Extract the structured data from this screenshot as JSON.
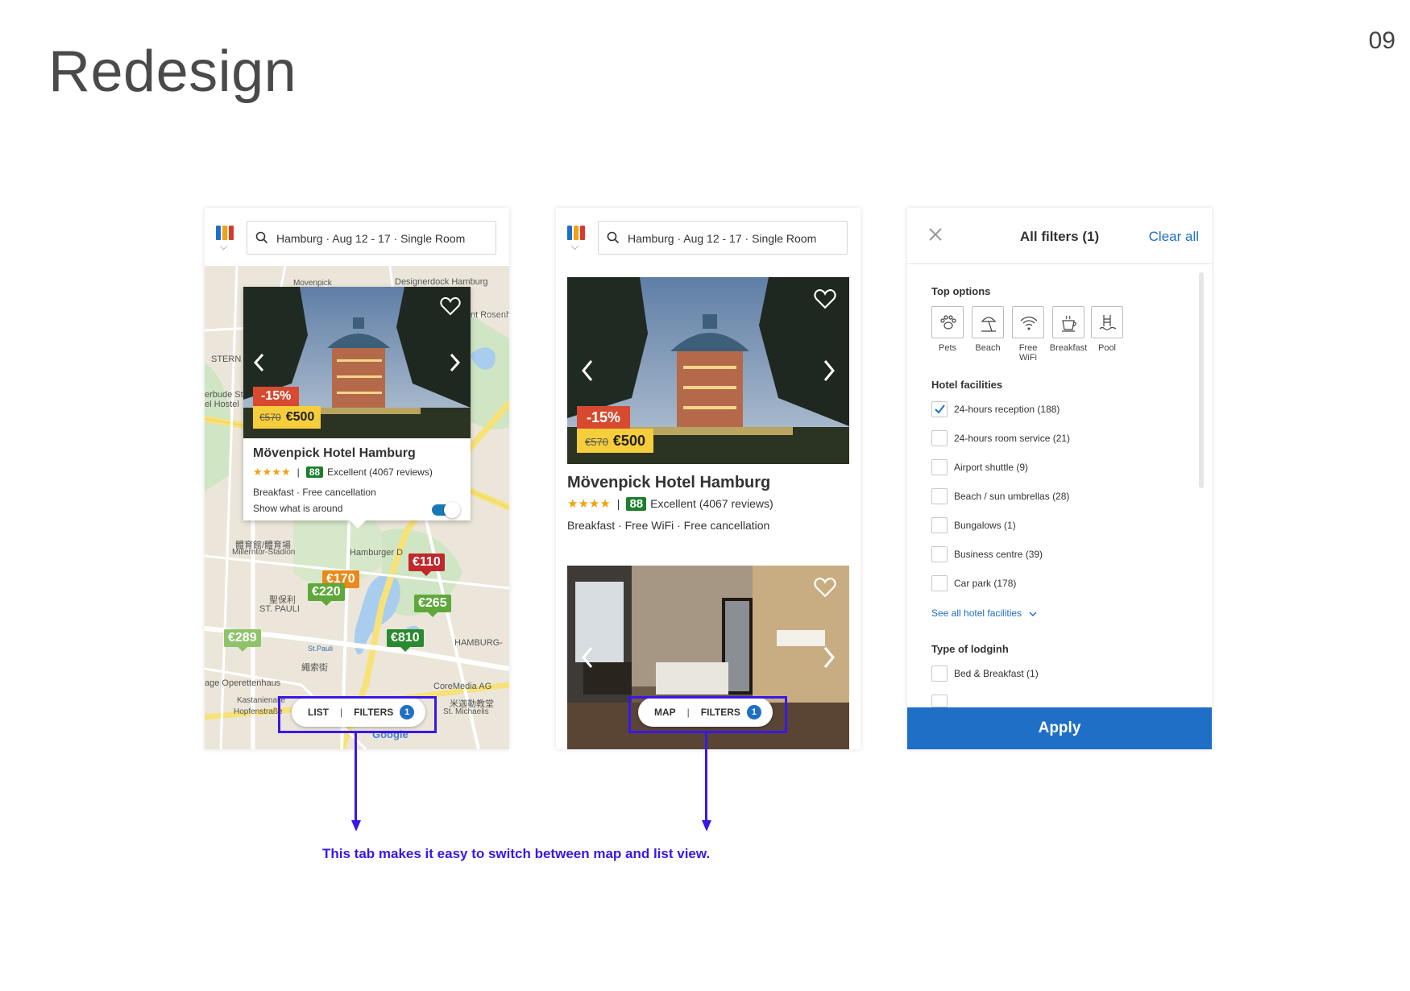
{
  "slide": {
    "title": "Redesign",
    "page_number": "09"
  },
  "search": {
    "query": "Hamburg · Aug 12 - 17 · Single Room"
  },
  "hotel": {
    "name": "Mövenpick Hotel Hamburg",
    "discount": "-15%",
    "old_price": "€570",
    "price": "€500",
    "stars": "★★★★",
    "score": "88",
    "rating_text": "Excellent (4067 reviews)",
    "map_features": "Breakfast · Free cancellation",
    "list_features": "Breakfast · Free WiFi · Free cancellation",
    "show_around": "Show what is around",
    "show_around_on": true
  },
  "map": {
    "pins": [
      {
        "label": "€110",
        "color": "#c0282d"
      },
      {
        "label": "€170",
        "color": "#e88a1a"
      },
      {
        "label": "€220",
        "color": "#5fa83c"
      },
      {
        "label": "€265",
        "color": "#5fa83c"
      },
      {
        "label": "€289",
        "color": "#8fc36a"
      },
      {
        "label": "€810",
        "color": "#2a8a2f"
      }
    ],
    "labels": {
      "a": "Designerdock Hamburg",
      "b": "nt Rosenh",
      "c": "STERN",
      "d": "erbude St",
      "e": "el Hostel",
      "f": "體育館/體育場",
      "g": "Millerntor-Stadion",
      "h": "Hamburger D",
      "i": "聖保利",
      "j": "ST. PAULI",
      "k": "St.Pauli",
      "l": "HAMBURG-",
      "m": "age Operettenhaus",
      "n": "CoreMedia AG",
      "o": "Kastanienalle",
      "p": "Hopfenstraße",
      "q": "Google",
      "r": "Movenpick",
      "s": "米迦勒教堂",
      "t": "St. Michaelis",
      "u": "繩索街"
    }
  },
  "tabs_map": {
    "left": "LIST",
    "filters": "FILTERS",
    "count": "1"
  },
  "tabs_list": {
    "left": "MAP",
    "filters": "FILTERS",
    "count": "1"
  },
  "annotation": "This tab makes it easy to switch between map and list view.",
  "filters": {
    "title": "All filters (1)",
    "clear": "Clear all",
    "top_options_title": "Top options",
    "top_options": [
      "Pets",
      "Beach",
      "Free WiFi",
      "Breakfast",
      "Pool"
    ],
    "facilities_title": "Hotel facilities",
    "facilities": [
      {
        "label": "24-hours reception (188)",
        "checked": true
      },
      {
        "label": "24-hours room service (21)",
        "checked": false
      },
      {
        "label": "Airport shuttle (9)",
        "checked": false
      },
      {
        "label": "Beach / sun umbrellas (28)",
        "checked": false
      },
      {
        "label": "Bungalows (1)",
        "checked": false
      },
      {
        "label": "Business centre (39)",
        "checked": false
      },
      {
        "label": "Car park (178)",
        "checked": false
      }
    ],
    "see_all": "See all hotel facilities",
    "lodging_title": "Type of lodginh",
    "lodging": [
      {
        "label": "Bed & Breakfast (1)",
        "checked": false
      }
    ],
    "apply": "Apply"
  },
  "colors": {
    "accent": "#1f6fc6",
    "callout": "#3a17e8",
    "score": "#1c7f2d",
    "discount": "#d84a2f",
    "price": "#f6cd3a"
  }
}
